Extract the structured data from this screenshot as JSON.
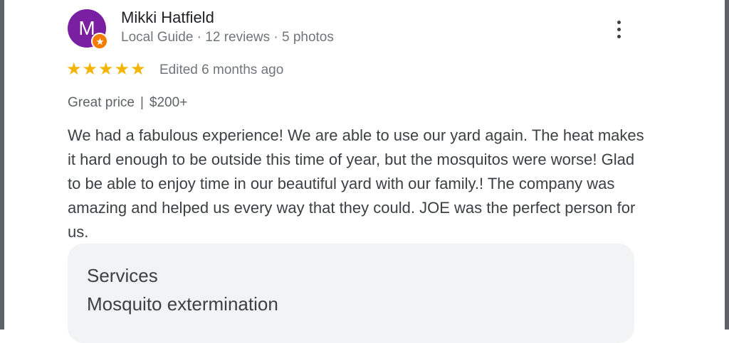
{
  "reviewer": {
    "avatar_initial": "M",
    "name": "Mikki Hatfield",
    "meta": "Local Guide · 12 reviews · 5 photos"
  },
  "rating": {
    "stars": 5,
    "max": 5,
    "star_glyph": "★",
    "edited": "Edited 6 months ago"
  },
  "price": {
    "label": "Great price",
    "separator": "|",
    "amount": "$200+"
  },
  "review": {
    "text": "We had a fabulous experience! We are able to use our yard again. The heat makes it hard enough to be outside this time of year, but the mosquitos were worse! Glad to be able to enjoy time in our beautiful yard with our family.! The company was amazing and helped us every way that they could. JOE was the perfect person for us."
  },
  "services": {
    "title": "Services",
    "value": "Mosquito extermination"
  },
  "icons": {
    "menu": "more-vert-icon",
    "guide_badge": "local-guide-badge-icon",
    "star": "star-icon"
  },
  "colors": {
    "avatar": "#7b1fa2",
    "badge": "#f57c00",
    "star": "#f4b400",
    "card": "#f1f3f4"
  }
}
